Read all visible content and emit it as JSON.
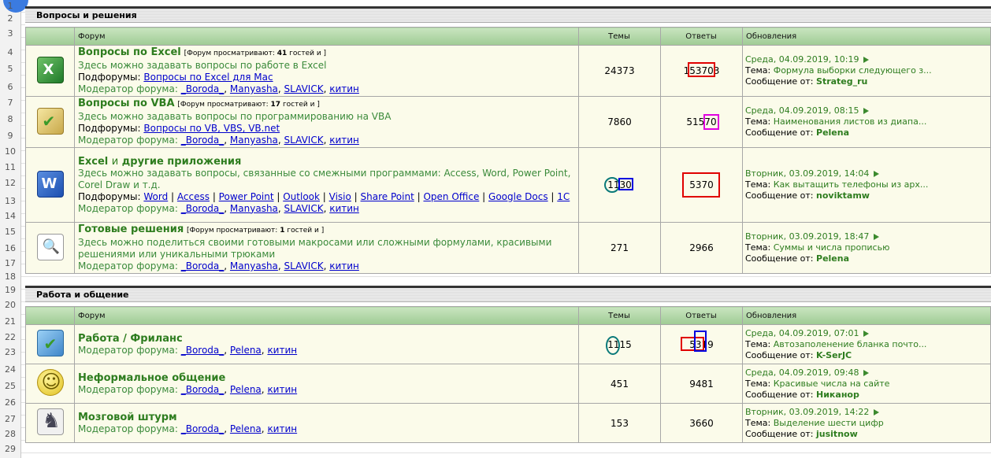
{
  "row_numbers": [
    "1",
    "2",
    "3",
    "4",
    "5",
    "6",
    "7",
    "8",
    "9",
    "10",
    "11",
    "12",
    "13",
    "14",
    "15",
    "16",
    "17",
    "18",
    "19",
    "20",
    "21",
    "22",
    "23",
    "24",
    "25",
    "26",
    "27",
    "28",
    "29"
  ],
  "sections": [
    {
      "title": "Вопросы и решения",
      "headers": {
        "forum": "Форум",
        "topics": "Темы",
        "replies": "Ответы",
        "updates": "Обновления"
      },
      "forums": [
        {
          "icon": "excel-icon",
          "title": "Вопросы по Excel",
          "viewers_pre": "[Форум просматривают:",
          "viewers_count": "41",
          "viewers_post": "гостей и ]",
          "desc": "Здесь можно задавать вопросы по работе в Excel",
          "subforums_label": "Подфорумы:",
          "subforums": [
            "Вопросы по Excel для Mac"
          ],
          "mod_label": "Модератор форума:",
          "mods": [
            "_Boroda_",
            "Manyasha",
            "SLAVICK",
            "китин"
          ],
          "topics": "24373",
          "replies": "153703",
          "date": "Среда, 04.09.2019, 10:19",
          "topic_label": "Тема:",
          "topic": "Формула выборки следующего з...",
          "from_label": "Сообщение от:",
          "author": "Strateg_ru"
        },
        {
          "icon": "vba-icon",
          "title": "Вопросы по VBA",
          "viewers_pre": "[Форум просматривают:",
          "viewers_count": "17",
          "viewers_post": "гостей и ]",
          "desc": "Здесь можно задавать вопросы по программированию на VBA",
          "subforums_label": "Подфорумы:",
          "subforums": [
            "Вопросы по VB, VBS, VB.net"
          ],
          "mod_label": "Модератор форума:",
          "mods": [
            "_Boroda_",
            "Manyasha",
            "SLAVICK",
            "китин"
          ],
          "topics": "7860",
          "replies": "51570",
          "date": "Среда, 04.09.2019, 08:15",
          "topic_label": "Тема:",
          "topic": "Наименования листов из диапа...",
          "from_label": "Сообщение от:",
          "author": "Pelena"
        },
        {
          "icon": "word-icon",
          "title_a": "Excel",
          "title_b": "и",
          "title_c": "другие приложения",
          "desc": "Здесь можно задавать вопросы, связанные со смежными программами: Access, Word, Power Point, Corel Draw и т.д.",
          "subforums_label": "Подфорумы:",
          "subforums": [
            "Word",
            "Access",
            "Power Point",
            "Outlook",
            "Visio",
            "Share Point",
            "Open Office",
            "Google Docs",
            "1C"
          ],
          "mod_label": "Модератор форума:",
          "mods": [
            "_Boroda_",
            "Manyasha",
            "SLAVICK",
            "китин"
          ],
          "topics": "1130",
          "replies": "5370",
          "date": "Вторник, 03.09.2019, 14:04",
          "topic_label": "Тема:",
          "topic": "Как вытащить телефоны из арх...",
          "from_label": "Сообщение от:",
          "author": "noviktamw"
        },
        {
          "icon": "search-icon",
          "title": "Готовые решения",
          "viewers_pre": "[Форум просматривают:",
          "viewers_count": "1",
          "viewers_post": "гостей и ]",
          "desc": "Здесь можно поделиться своими готовыми макросами или сложными формулами, красивыми решениями или уникальными трюками",
          "mod_label": "Модератор форума:",
          "mods": [
            "_Boroda_",
            "Manyasha",
            "SLAVICK",
            "китин"
          ],
          "topics": "271",
          "replies": "2966",
          "date": "Вторник, 03.09.2019, 18:47",
          "topic_label": "Тема:",
          "topic": "Суммы и числа прописью",
          "from_label": "Сообщение от:",
          "author": "Pelena"
        }
      ]
    },
    {
      "title": "Работа и общение",
      "headers": {
        "forum": "Форум",
        "topics": "Темы",
        "replies": "Ответы",
        "updates": "Обновления"
      },
      "forums": [
        {
          "icon": "work-icon",
          "title": "Работа / Фриланс",
          "mod_label": "Модератор форума:",
          "mods": [
            "_Boroda_",
            "Pelena",
            "китин"
          ],
          "topics": "1115",
          "replies": "5319",
          "date": "Среда, 04.09.2019, 07:01",
          "topic_label": "Тема:",
          "topic": "Автозаполенение бланка почто...",
          "from_label": "Сообщение от:",
          "author": "K-SerJC"
        },
        {
          "icon": "smile-icon",
          "title": "Неформальное общение",
          "mod_label": "Модератор форума:",
          "mods": [
            "_Boroda_",
            "Pelena",
            "китин"
          ],
          "topics": "451",
          "replies": "9481",
          "date": "Среда, 04.09.2019, 09:48",
          "topic_label": "Тема:",
          "topic": "Красивые числа на сайте",
          "from_label": "Сообщение от:",
          "author": "Никанор"
        },
        {
          "icon": "chess-icon",
          "title": "Мозговой штурм",
          "mod_label": "Модератор форума:",
          "mods": [
            "_Boroda_",
            "Pelena",
            "китин"
          ],
          "topics": "153",
          "replies": "3660",
          "date": "Вторник, 03.09.2019, 14:22",
          "topic_label": "Тема:",
          "topic": "Выделение шести цифр",
          "from_label": "Сообщение от:",
          "author": "jusitnow"
        }
      ]
    }
  ],
  "colors": {
    "title_green": "#2e7d1f",
    "link_blue": "#0000cc",
    "header_green": "#9fcb94",
    "row_bg": "#fbfbea"
  }
}
